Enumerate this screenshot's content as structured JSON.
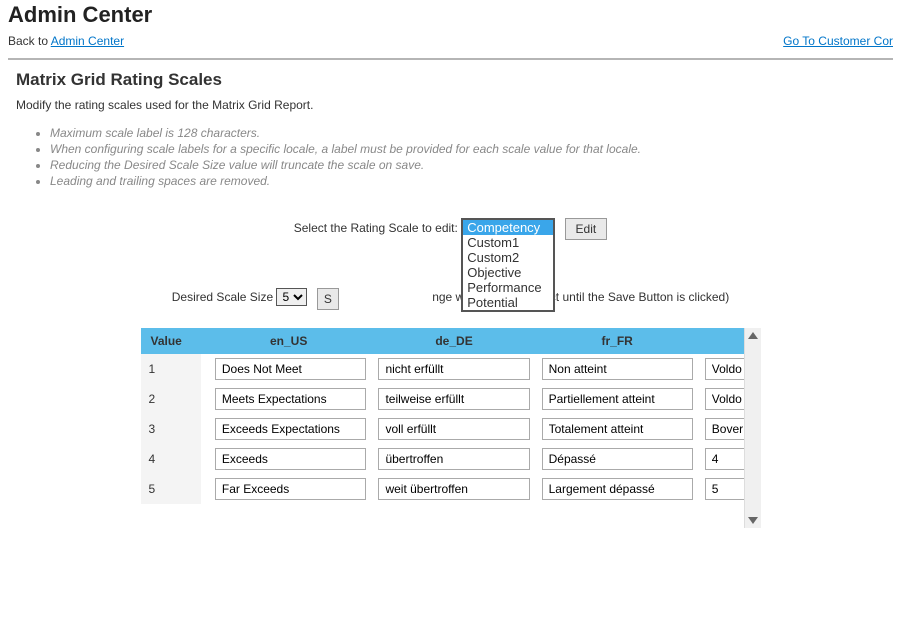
{
  "header": {
    "title": "Admin Center",
    "back_prefix": "Back to ",
    "back_link": "Admin Center",
    "right_link": "Go To Customer Cor"
  },
  "section": {
    "title": "Matrix Grid Rating Scales",
    "desc": "Modify the rating scales used for the Matrix Grid Report.",
    "hints": [
      "Maximum scale label is 128 characters.",
      "When configuring scale labels for a specific locale, a label must be provided for each scale value for that locale.",
      "Reducing the Desired Scale Size value will truncate the scale on save.",
      "Leading and trailing spaces are removed."
    ]
  },
  "controls": {
    "select_label": "Select the Rating Scale to edit:",
    "options": [
      "Competency",
      "Custom1",
      "Custom2",
      "Objective",
      "Performance",
      "Potential"
    ],
    "edit_btn": "Edit",
    "size_label": "Desired Scale Size",
    "size_value": "5",
    "size_btn_fragment": "S",
    "size_note": "nge will NOT take effect until the Save Button is clicked)"
  },
  "table": {
    "headers": {
      "value": "Value",
      "en": "en_US",
      "de": "de_DE",
      "fr": "fr_FR"
    },
    "rows": [
      {
        "v": "1",
        "en": "Does Not Meet",
        "de": "nicht erfüllt",
        "fr": "Non atteint",
        "x": "Voldo"
      },
      {
        "v": "2",
        "en": "Meets Expectations",
        "de": "teilweise erfüllt",
        "fr": "Partiellement atteint",
        "x": "Voldo"
      },
      {
        "v": "3",
        "en": "Exceeds Expectations",
        "de": "voll erfüllt",
        "fr": "Totalement atteint",
        "x": "Bover"
      },
      {
        "v": "4",
        "en": "Exceeds",
        "de": "übertroffen",
        "fr": "Dépassé",
        "x": "4"
      },
      {
        "v": "5",
        "en": "Far Exceeds",
        "de": "weit übertroffen",
        "fr": "Largement dépassé",
        "x": "5"
      }
    ]
  }
}
